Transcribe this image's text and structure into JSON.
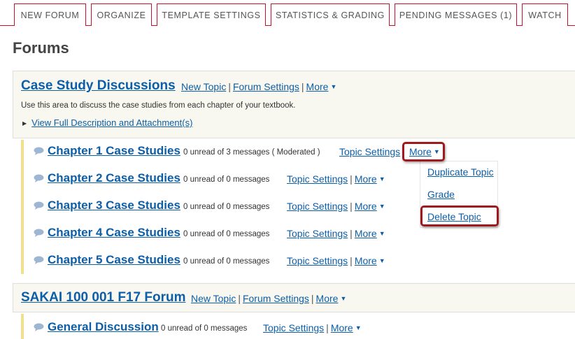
{
  "tabs": [
    "NEW FORUM",
    "ORGANIZE",
    "TEMPLATE SETTINGS",
    "STATISTICS & GRADING",
    "PENDING MESSAGES (1)",
    "WATCH"
  ],
  "page_title": "Forums",
  "forums": [
    {
      "title": "Case Study Discussions",
      "links": {
        "new_topic": "New Topic",
        "settings": "Forum Settings",
        "more": "More"
      },
      "description": "Use this area to discuss the case studies from each chapter of your textbook.",
      "full_description": "View Full Description and Attachment(s)",
      "topics": [
        {
          "title": "Chapter 1 Case Studies",
          "meta": "0 unread of 3 messages ( Moderated )",
          "settings": "Topic Settings",
          "more": "More"
        },
        {
          "title": "Chapter 2 Case Studies",
          "meta": "0 unread of 0 messages",
          "settings": "Topic Settings",
          "more": "More"
        },
        {
          "title": "Chapter 3 Case Studies",
          "meta": "0 unread of 0 messages",
          "settings": "Topic Settings",
          "more": "More"
        },
        {
          "title": "Chapter 4 Case Studies",
          "meta": "0 unread of 0 messages",
          "settings": "Topic Settings",
          "more": "More"
        },
        {
          "title": "Chapter 5 Case Studies",
          "meta": "0 unread of 0 messages",
          "settings": "Topic Settings",
          "more": "More"
        }
      ]
    },
    {
      "title": "SAKAI 100 001 F17 Forum",
      "links": {
        "new_topic": "New Topic",
        "settings": "Forum Settings",
        "more": "More"
      },
      "topics": [
        {
          "title": "General Discussion",
          "meta": "0 unread of 0 messages",
          "settings": "Topic Settings",
          "more": "More"
        }
      ]
    }
  ],
  "dropdown": [
    "Duplicate Topic",
    "Grade",
    "Delete Topic"
  ],
  "colors": {
    "brand_red": "#c8102e",
    "link_blue": "#0d5ea8",
    "highlight": "#a0191c"
  }
}
